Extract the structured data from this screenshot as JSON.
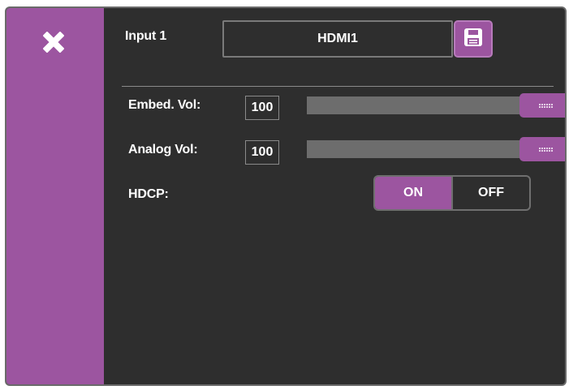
{
  "colors": {
    "accent": "#9c55a0",
    "panel_bg": "#2e2e2e",
    "track": "#636363"
  },
  "header": {
    "input_label": "Input 1",
    "input_name": "HDMI1",
    "save_icon": "floppy-disk-icon",
    "close_icon": "close-x-icon"
  },
  "embed_vol": {
    "label": "Embed. Vol:",
    "value": "100",
    "level": 1.0
  },
  "analog_vol": {
    "label": "Analog Vol:",
    "value": "100",
    "level": 1.0
  },
  "hdcp": {
    "label": "HDCP:",
    "on_label": "ON",
    "off_label": "OFF",
    "selected": "ON"
  }
}
